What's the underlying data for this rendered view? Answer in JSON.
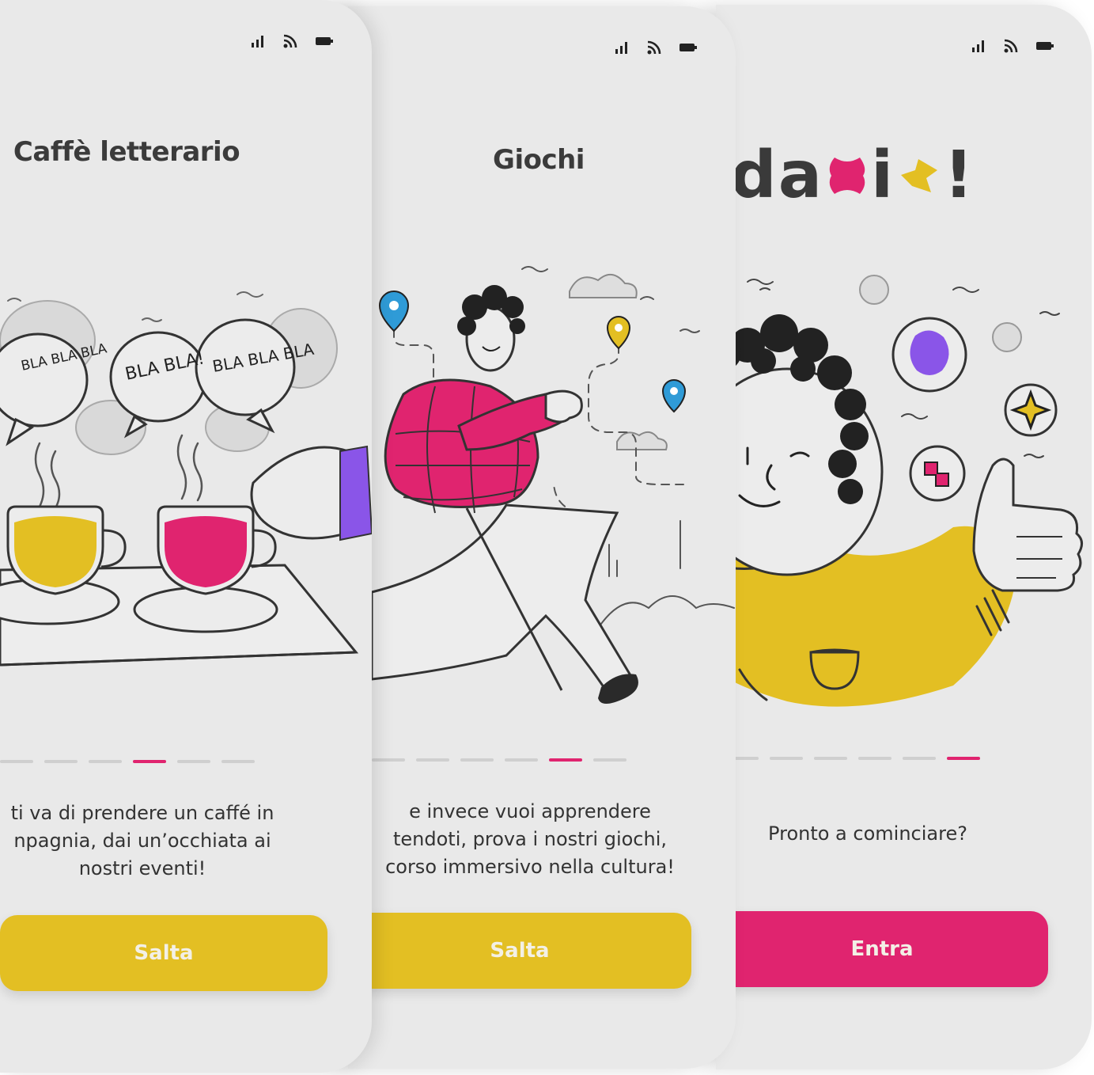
{
  "colors": {
    "accent_pink": "#e0246f",
    "accent_yellow": "#e3bf23",
    "accent_purple": "#8a55e8",
    "accent_blue": "#2f9bd7",
    "text_dark": "#3b3b3b",
    "screen_bg": "#e9e9e9"
  },
  "screens": [
    {
      "title": "Caffè letterario",
      "bubble_texts": [
        "BLA BLA BLA",
        "BLA BLA!",
        "BLA BLA BLA"
      ],
      "description": "ti va di prendere un caffé in\nnpagnia, dai un’occhiata ai\nnostri eventi!",
      "button_label": "Salta",
      "step_count": 6,
      "active_step": 4
    },
    {
      "title": "Giochi",
      "description": "e invece vuoi apprendere\ntendoti, prova i nostri giochi,\ncorso immersivo nella cultura!",
      "button_label": "Salta",
      "step_count": 6,
      "active_step": 5
    },
    {
      "logo": "dai!",
      "description": "Pronto a cominciare?",
      "button_label": "Entra",
      "step_count": 6,
      "active_step": 6
    }
  ],
  "status_icons": [
    "signal-icon",
    "wifi-icon",
    "battery-icon"
  ]
}
